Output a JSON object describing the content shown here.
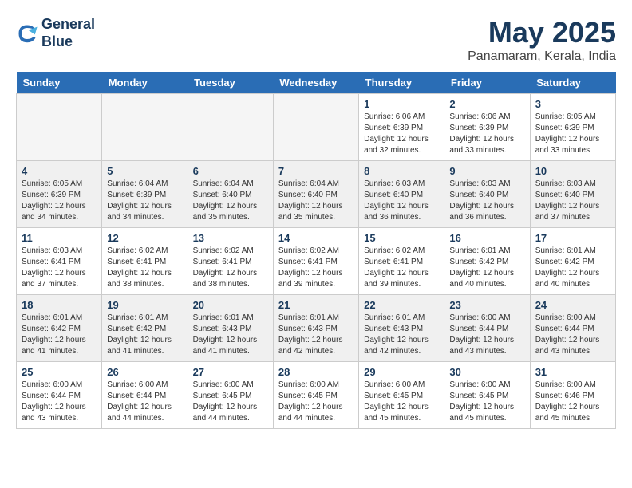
{
  "header": {
    "logo_line1": "General",
    "logo_line2": "Blue",
    "title": "May 2025",
    "location": "Panamaram, Kerala, India"
  },
  "weekdays": [
    "Sunday",
    "Monday",
    "Tuesday",
    "Wednesday",
    "Thursday",
    "Friday",
    "Saturday"
  ],
  "weeks": [
    [
      {
        "day": "",
        "empty": true
      },
      {
        "day": "",
        "empty": true
      },
      {
        "day": "",
        "empty": true
      },
      {
        "day": "",
        "empty": true
      },
      {
        "day": "1",
        "sunrise": "6:06 AM",
        "sunset": "6:39 PM",
        "daylight": "12 hours and 32 minutes."
      },
      {
        "day": "2",
        "sunrise": "6:06 AM",
        "sunset": "6:39 PM",
        "daylight": "12 hours and 33 minutes."
      },
      {
        "day": "3",
        "sunrise": "6:05 AM",
        "sunset": "6:39 PM",
        "daylight": "12 hours and 33 minutes."
      }
    ],
    [
      {
        "day": "4",
        "sunrise": "6:05 AM",
        "sunset": "6:39 PM",
        "daylight": "12 hours and 34 minutes."
      },
      {
        "day": "5",
        "sunrise": "6:04 AM",
        "sunset": "6:39 PM",
        "daylight": "12 hours and 34 minutes."
      },
      {
        "day": "6",
        "sunrise": "6:04 AM",
        "sunset": "6:40 PM",
        "daylight": "12 hours and 35 minutes."
      },
      {
        "day": "7",
        "sunrise": "6:04 AM",
        "sunset": "6:40 PM",
        "daylight": "12 hours and 35 minutes."
      },
      {
        "day": "8",
        "sunrise": "6:03 AM",
        "sunset": "6:40 PM",
        "daylight": "12 hours and 36 minutes."
      },
      {
        "day": "9",
        "sunrise": "6:03 AM",
        "sunset": "6:40 PM",
        "daylight": "12 hours and 36 minutes."
      },
      {
        "day": "10",
        "sunrise": "6:03 AM",
        "sunset": "6:40 PM",
        "daylight": "12 hours and 37 minutes."
      }
    ],
    [
      {
        "day": "11",
        "sunrise": "6:03 AM",
        "sunset": "6:41 PM",
        "daylight": "12 hours and 37 minutes."
      },
      {
        "day": "12",
        "sunrise": "6:02 AM",
        "sunset": "6:41 PM",
        "daylight": "12 hours and 38 minutes."
      },
      {
        "day": "13",
        "sunrise": "6:02 AM",
        "sunset": "6:41 PM",
        "daylight": "12 hours and 38 minutes."
      },
      {
        "day": "14",
        "sunrise": "6:02 AM",
        "sunset": "6:41 PM",
        "daylight": "12 hours and 39 minutes."
      },
      {
        "day": "15",
        "sunrise": "6:02 AM",
        "sunset": "6:41 PM",
        "daylight": "12 hours and 39 minutes."
      },
      {
        "day": "16",
        "sunrise": "6:01 AM",
        "sunset": "6:42 PM",
        "daylight": "12 hours and 40 minutes."
      },
      {
        "day": "17",
        "sunrise": "6:01 AM",
        "sunset": "6:42 PM",
        "daylight": "12 hours and 40 minutes."
      }
    ],
    [
      {
        "day": "18",
        "sunrise": "6:01 AM",
        "sunset": "6:42 PM",
        "daylight": "12 hours and 41 minutes."
      },
      {
        "day": "19",
        "sunrise": "6:01 AM",
        "sunset": "6:42 PM",
        "daylight": "12 hours and 41 minutes."
      },
      {
        "day": "20",
        "sunrise": "6:01 AM",
        "sunset": "6:43 PM",
        "daylight": "12 hours and 41 minutes."
      },
      {
        "day": "21",
        "sunrise": "6:01 AM",
        "sunset": "6:43 PM",
        "daylight": "12 hours and 42 minutes."
      },
      {
        "day": "22",
        "sunrise": "6:01 AM",
        "sunset": "6:43 PM",
        "daylight": "12 hours and 42 minutes."
      },
      {
        "day": "23",
        "sunrise": "6:00 AM",
        "sunset": "6:44 PM",
        "daylight": "12 hours and 43 minutes."
      },
      {
        "day": "24",
        "sunrise": "6:00 AM",
        "sunset": "6:44 PM",
        "daylight": "12 hours and 43 minutes."
      }
    ],
    [
      {
        "day": "25",
        "sunrise": "6:00 AM",
        "sunset": "6:44 PM",
        "daylight": "12 hours and 43 minutes."
      },
      {
        "day": "26",
        "sunrise": "6:00 AM",
        "sunset": "6:44 PM",
        "daylight": "12 hours and 44 minutes."
      },
      {
        "day": "27",
        "sunrise": "6:00 AM",
        "sunset": "6:45 PM",
        "daylight": "12 hours and 44 minutes."
      },
      {
        "day": "28",
        "sunrise": "6:00 AM",
        "sunset": "6:45 PM",
        "daylight": "12 hours and 44 minutes."
      },
      {
        "day": "29",
        "sunrise": "6:00 AM",
        "sunset": "6:45 PM",
        "daylight": "12 hours and 45 minutes."
      },
      {
        "day": "30",
        "sunrise": "6:00 AM",
        "sunset": "6:45 PM",
        "daylight": "12 hours and 45 minutes."
      },
      {
        "day": "31",
        "sunrise": "6:00 AM",
        "sunset": "6:46 PM",
        "daylight": "12 hours and 45 minutes."
      }
    ]
  ]
}
